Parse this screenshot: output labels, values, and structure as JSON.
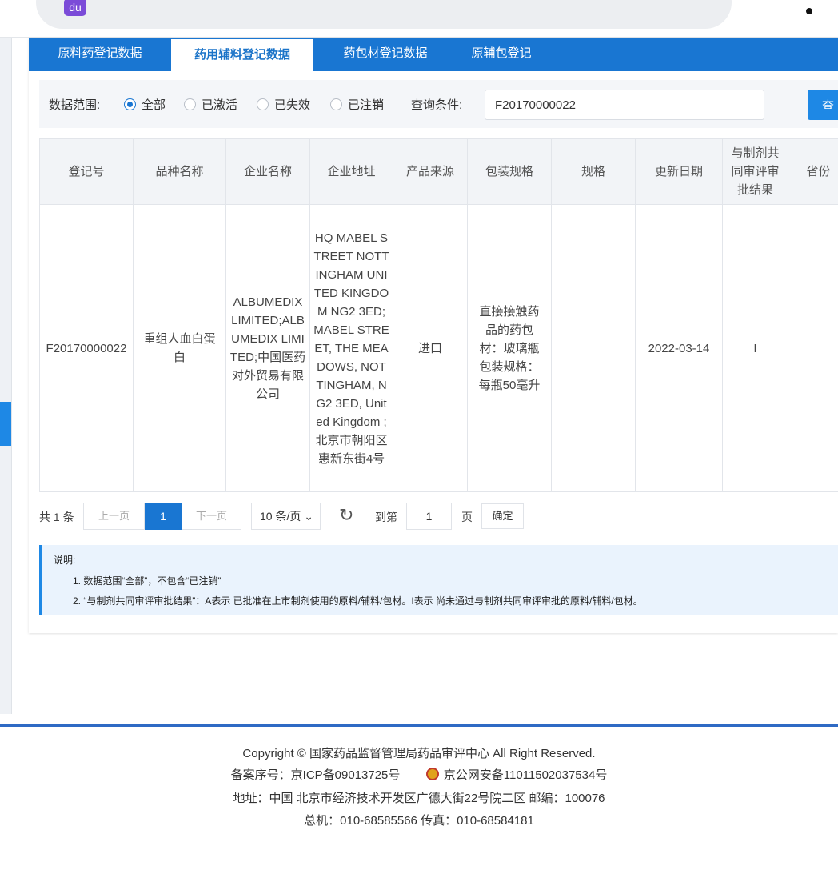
{
  "tabs": [
    {
      "label": "原料药登记数据",
      "active": false
    },
    {
      "label": "药用辅料登记数据",
      "active": true
    },
    {
      "label": "药包材登记数据",
      "active": false
    },
    {
      "label": "原辅包登记",
      "active": false
    }
  ],
  "filter": {
    "scope_label": "数据范围:",
    "options": [
      {
        "label": "全部",
        "selected": true
      },
      {
        "label": "已激活",
        "selected": false
      },
      {
        "label": "已失效",
        "selected": false
      },
      {
        "label": "已注销",
        "selected": false
      }
    ],
    "query_label": "查询条件:",
    "query_value": "F20170000022",
    "search_button": "查"
  },
  "table": {
    "columns": [
      "登记号",
      "品种名称",
      "企业名称",
      "企业地址",
      "产品来源",
      "包装规格",
      "规格",
      "更新日期",
      "与制剂共同审评审批结果",
      "省份"
    ],
    "rows": [
      {
        "reg_no": "F20170000022",
        "name": "重组人血白蛋白",
        "company": "ALBUMEDIX LIMITED;ALBUMEDIX LIMITED;中国医药对外贸易有限公司",
        "address": "HQ MABEL STREET NOTTINGHAM UNITED KINGDOM NG2 3ED;MABEL STREET, THE MEADOWS, NOTTINGHAM, NG2 3ED, United Kingdom ;北京市朝阳区惠新东街4号",
        "source": "进口",
        "packaging": "直接接触药品的药包材：玻璃瓶包装规格：每瓶50毫升",
        "spec": "",
        "updated": "2022-03-14",
        "review_result": "I",
        "province": ""
      }
    ]
  },
  "pager": {
    "total": "共 1 条",
    "prev": "上一页",
    "current": "1",
    "next": "下一页",
    "page_size": "10 条/页",
    "goto_label": "到第",
    "goto_value": "1",
    "page_unit": "页",
    "confirm": "确定"
  },
  "notes": {
    "title": "说明:",
    "line1": "1. 数据范围“全部”，不包含“已注销”",
    "line2": "2. “与制剂共同审评审批结果”：A表示 已批准在上市制剂使用的原料/辅料/包材。I表示 尚未通过与制剂共同审评审批的原料/辅料/包材。"
  },
  "footer": {
    "copyright": "Copyright © 国家药品监督管理局药品审评中心   All Right Reserved.",
    "icp": "备案序号：京ICP备09013725号",
    "police": "京公网安备11011502037534号",
    "address": "地址：中国 北京市经济技术开发区广德大街22号院二区      邮编：100076",
    "phone": "总机：010-68585566      传真：010-68584181"
  }
}
